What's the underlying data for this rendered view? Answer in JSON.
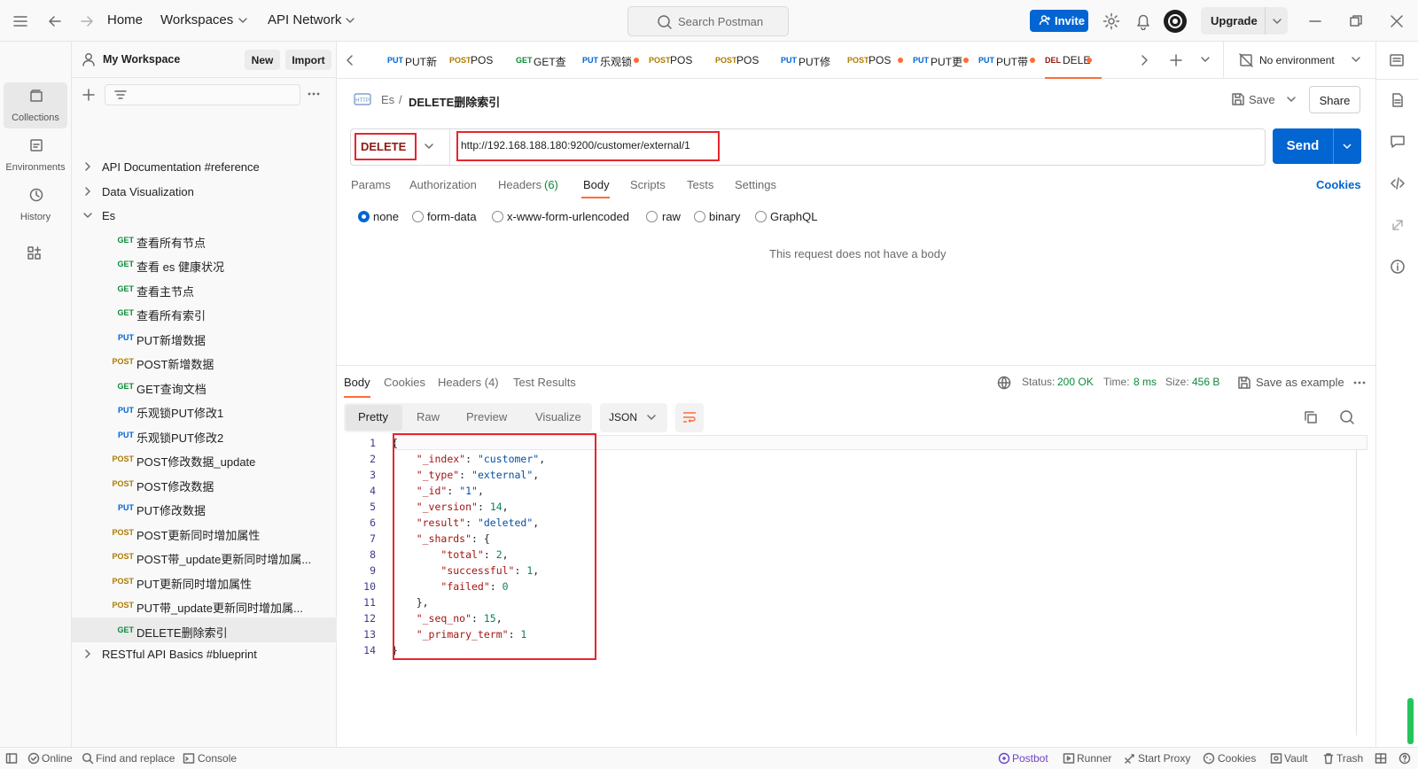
{
  "topbar": {
    "home": "Home",
    "workspaces": "Workspaces",
    "api_network": "API Network",
    "search_placeholder": "Search Postman",
    "invite": "Invite",
    "upgrade": "Upgrade"
  },
  "rail": {
    "collections": "Collections",
    "environments": "Environments",
    "history": "History"
  },
  "sidebar": {
    "workspace": "My Workspace",
    "new_btn": "New",
    "import_btn": "Import",
    "tree": [
      {
        "label": "API Documentation #reference",
        "method": "",
        "type": "folder"
      },
      {
        "label": "Data Visualization",
        "method": "",
        "type": "folder"
      },
      {
        "label": "Es",
        "method": "",
        "type": "folder-open"
      },
      {
        "label": "查看所有节点",
        "method": "GET",
        "type": "req"
      },
      {
        "label": "查看 es 健康状况",
        "method": "GET",
        "type": "req"
      },
      {
        "label": "查看主节点",
        "method": "GET",
        "type": "req"
      },
      {
        "label": "查看所有索引",
        "method": "GET",
        "type": "req"
      },
      {
        "label": "PUT新增数据",
        "method": "PUT",
        "type": "req"
      },
      {
        "label": "POST新增数据",
        "method": "POST",
        "type": "req"
      },
      {
        "label": "GET查询文档",
        "method": "GET",
        "type": "req"
      },
      {
        "label": "乐观锁PUT修改1",
        "method": "PUT",
        "type": "req"
      },
      {
        "label": "乐观锁PUT修改2",
        "method": "PUT",
        "type": "req"
      },
      {
        "label": "POST修改数据_update",
        "method": "POST",
        "type": "req"
      },
      {
        "label": "POST修改数据",
        "method": "POST",
        "type": "req"
      },
      {
        "label": "PUT修改数据",
        "method": "PUT",
        "type": "req"
      },
      {
        "label": "POST更新同时增加属性",
        "method": "POST",
        "type": "req"
      },
      {
        "label": "POST带_update更新同时增加属...",
        "method": "POST",
        "type": "req"
      },
      {
        "label": "PUT更新同时增加属性",
        "method": "POST",
        "type": "req"
      },
      {
        "label": "PUT带_update更新同时增加属...",
        "method": "POST",
        "type": "req"
      },
      {
        "label": "DELETE删除索引",
        "method": "GET",
        "type": "req-selected"
      },
      {
        "label": "RESTful API Basics #blueprint",
        "method": "",
        "type": "folder"
      }
    ]
  },
  "tabs": [
    {
      "method": "PUT",
      "label": "PUT新",
      "dot": false
    },
    {
      "method": "POST",
      "label": "POS",
      "dot": false
    },
    {
      "method": "GET",
      "label": "GET查",
      "dot": false
    },
    {
      "method": "PUT",
      "label": "乐观锁",
      "dot": true
    },
    {
      "method": "POST",
      "label": "POS",
      "dot": false
    },
    {
      "method": "POST",
      "label": "POS",
      "dot": false
    },
    {
      "method": "PUT",
      "label": "PUT修",
      "dot": false
    },
    {
      "method": "POST",
      "label": "POS",
      "dot": true
    },
    {
      "method": "PUT",
      "label": "PUT更",
      "dot": true
    },
    {
      "method": "PUT",
      "label": "PUT带",
      "dot": true
    },
    {
      "method": "DEL",
      "label": "DELE",
      "dot": true
    }
  ],
  "environment": "No environment",
  "request": {
    "breadcrumb_parent": "Es",
    "breadcrumb_sep": "/",
    "title": "DELETE删除索引",
    "save": "Save",
    "share": "Share",
    "method": "DELETE",
    "url": "http://192.168.188.180:9200/customer/external/1",
    "send": "Send",
    "subtabs": {
      "params": "Params",
      "authorization": "Authorization",
      "headers": "Headers",
      "headers_count": "(6)",
      "body": "Body",
      "scripts": "Scripts",
      "tests": "Tests",
      "settings": "Settings",
      "cookies": "Cookies"
    },
    "body_types": [
      "none",
      "form-data",
      "x-www-form-urlencoded",
      "raw",
      "binary",
      "GraphQL"
    ],
    "body_selected": "none",
    "no_body": "This request does not have a body"
  },
  "response": {
    "tabs": {
      "body": "Body",
      "cookies": "Cookies",
      "headers": "Headers (4)",
      "test_results": "Test Results"
    },
    "status_label": "Status:",
    "status_value": "200 OK",
    "time_label": "Time:",
    "time_value": "8 ms",
    "size_label": "Size:",
    "size_value": "456 B",
    "save_example": "Save as example",
    "views": [
      "Pretty",
      "Raw",
      "Preview",
      "Visualize"
    ],
    "format": "JSON",
    "code_lines": [
      "{",
      "    \"_index\": \"customer\",",
      "    \"_type\": \"external\",",
      "    \"_id\": \"1\",",
      "    \"_version\": 14,",
      "    \"result\": \"deleted\",",
      "    \"_shards\": {",
      "        \"total\": 2,",
      "        \"successful\": 1,",
      "        \"failed\": 0",
      "    },",
      "    \"_seq_no\": 15,",
      "    \"_primary_term\": 1",
      "}"
    ]
  },
  "statusbar": {
    "online": "Online",
    "find_replace": "Find and replace",
    "console": "Console",
    "postbot": "Postbot",
    "runner": "Runner",
    "start_proxy": "Start Proxy",
    "cookies": "Cookies",
    "vault": "Vault",
    "trash": "Trash"
  }
}
